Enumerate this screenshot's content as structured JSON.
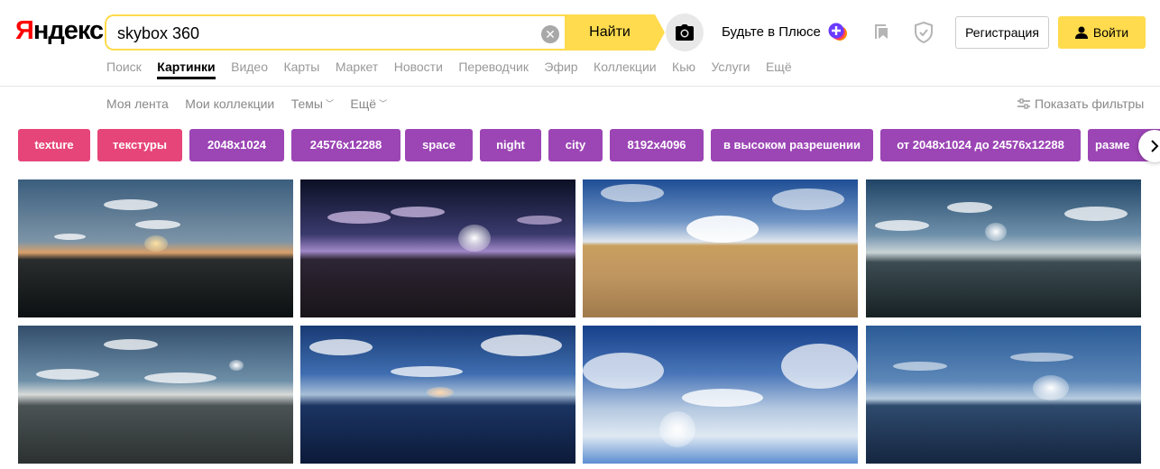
{
  "header": {
    "logo": "Яндекс",
    "logo_first": "Я",
    "logo_rest": "ндекс",
    "search": {
      "value": "skybox 360",
      "button_label": "Найти",
      "clear_icon": "close-icon"
    },
    "camera_icon": "camera-icon",
    "plus_label": "Будьте в Плюсе",
    "register_label": "Регистрация",
    "login_label": "Войти"
  },
  "services": [
    {
      "label": "Поиск",
      "active": false
    },
    {
      "label": "Картинки",
      "active": true
    },
    {
      "label": "Видео",
      "active": false
    },
    {
      "label": "Карты",
      "active": false
    },
    {
      "label": "Маркет",
      "active": false
    },
    {
      "label": "Новости",
      "active": false
    },
    {
      "label": "Переводчик",
      "active": false
    },
    {
      "label": "Эфир",
      "active": false
    },
    {
      "label": "Коллекции",
      "active": false
    },
    {
      "label": "Кью",
      "active": false
    },
    {
      "label": "Услуги",
      "active": false
    },
    {
      "label": "Ещё",
      "active": false
    }
  ],
  "subnav": {
    "items": [
      {
        "label": "Моя лента"
      },
      {
        "label": "Мои коллекции"
      },
      {
        "label": "Темы",
        "dropdown": true
      },
      {
        "label": "Ещё",
        "dropdown": true
      }
    ],
    "filters_label": "Показать фильтры"
  },
  "tags": [
    {
      "label": "texture",
      "color": "#e6457a"
    },
    {
      "label": "текстуры",
      "color": "#e6457a"
    },
    {
      "label": "2048x1024",
      "color": "#9c45b5"
    },
    {
      "label": "24576x12288",
      "color": "#9c45b5"
    },
    {
      "label": "space",
      "color": "#9c45b5"
    },
    {
      "label": "night",
      "color": "#9c45b5"
    },
    {
      "label": "city",
      "color": "#9c45b5"
    },
    {
      "label": "8192x4096",
      "color": "#9c45b5"
    },
    {
      "label": "в высоком разрешении",
      "color": "#9c45b5"
    },
    {
      "label": "от 2048x1024 до 24576x12288",
      "color": "#9c45b5"
    },
    {
      "label": "разме",
      "color": "#9c45b5"
    }
  ],
  "colors": {
    "accent_yellow": "#ffdb4d",
    "logo_red": "#ff0000",
    "tag_pink": "#e6457a",
    "tag_purple": "#9c45b5"
  }
}
